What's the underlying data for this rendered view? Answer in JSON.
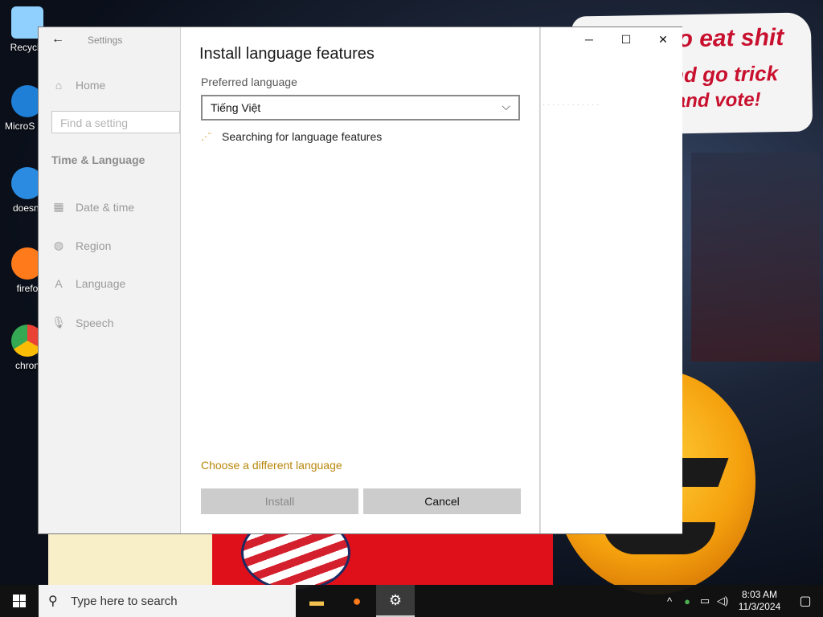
{
  "desktop": {
    "icons": [
      {
        "label": "Recycle",
        "color": "#8fd0ff"
      },
      {
        "label": "MicroS Edg",
        "color": "#1f7fd6"
      },
      {
        "label": "doesnt",
        "color": "#2a8be0"
      },
      {
        "label": "firefo",
        "color": "#ff7a1a"
      },
      {
        "label": "chron",
        "color": "#34a853"
      }
    ],
    "wallpaper_text": {
      "line1": "o eat shit",
      "line2": "nd go trick",
      "line3": "and vote!"
    }
  },
  "settings": {
    "app_title": "Settings",
    "back_icon": "back-arrow-icon",
    "home_label": "Home",
    "search_placeholder": "Find a setting",
    "section_title": "Time & Language",
    "nav_items": [
      {
        "label": "Date & time",
        "icon": "calendar-clock-icon"
      },
      {
        "label": "Region",
        "icon": "globe-icon"
      },
      {
        "label": "Language",
        "icon": "language-icon"
      },
      {
        "label": "Speech",
        "icon": "microphone-icon"
      }
    ],
    "window_controls": {
      "minimize": "─",
      "maximize": "☐",
      "close": "✕"
    }
  },
  "dialog": {
    "title": "Install language features",
    "preferred_label": "Preferred language",
    "selected_language": "Tiếng Việt",
    "status_text": "Searching for language features",
    "link_text": "Choose a different language",
    "install_label": "Install",
    "cancel_label": "Cancel",
    "link_color": "#b8860b"
  },
  "taskbar": {
    "search_placeholder": "Type here to search",
    "time": "8:03 AM",
    "date": "11/3/2024"
  }
}
